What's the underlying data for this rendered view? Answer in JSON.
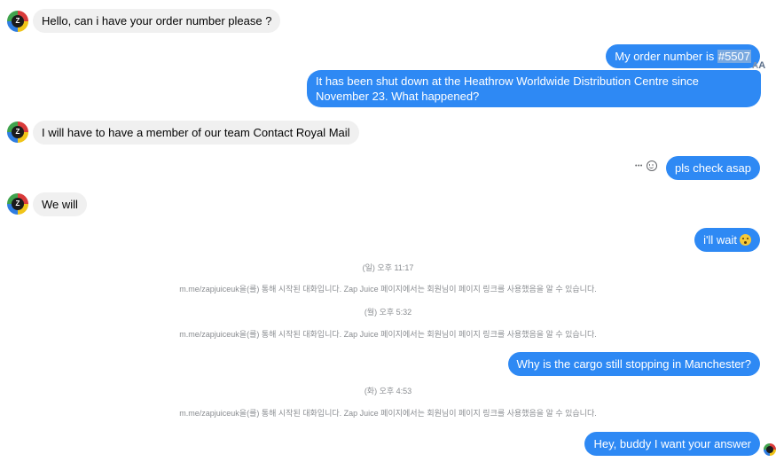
{
  "contact": {
    "avatar_icon": "zap-juice-logo-icon",
    "avatar_glyph": "Z"
  },
  "messages": [
    {
      "side": "in",
      "text": "Hello, can i have your order number please ?"
    },
    {
      "side": "out",
      "text_before": "My order number is ",
      "highlight": "#5507"
    },
    {
      "side": "out",
      "text": "It has been shut down at the Heathrow Worldwide Distribution Centre since November 23. What happened?"
    },
    {
      "side": "in",
      "text": "I will have to have a member of our team Contact Royal Mail"
    },
    {
      "side": "out",
      "text": "pls check asap"
    },
    {
      "side": "in",
      "text": "We will"
    },
    {
      "side": "out",
      "text": "i'll wait",
      "emoji": "pleading-face-icon"
    },
    {
      "side": "out",
      "text": "Why is the cargo still stopping in Manchester?"
    },
    {
      "side": "out",
      "text": "Hey, buddy I want your answer"
    }
  ],
  "system": [
    {
      "time": "(일) 오후 11:17",
      "note": "m.me/zapjuiceuk을(를) 통해 시작된 대화입니다. Zap Juice 페이지에서는 회원님이 페이지 링크를 사용했음을 알 수 있습니다."
    },
    {
      "time": "(월) 오후 5:32",
      "note": "m.me/zapjuiceuk을(를) 통해 시작된 대화입니다. Zap Juice 페이지에서는 회원님이 페이지 링크를 사용했음을 알 수 있습니다."
    },
    {
      "time": "(화) 오후 4:53",
      "note": "m.me/zapjuiceuk을(를) 통해 시작된 대화입니다. Zap Juice 페이지에서는 회원님이 페이지 링크를 사용했음을 알 수 있습니다."
    }
  ],
  "tools": {
    "more_icon": "more-horizontal-icon",
    "react_icon": "smiley-react-icon",
    "more_glyph": "•••"
  },
  "translate_badge": {
    "small": "A",
    "large": "A"
  },
  "colors": {
    "outgoing": "#2e89f4",
    "incoming": "#f0f0f0",
    "highlight": "#7aa9e0"
  }
}
